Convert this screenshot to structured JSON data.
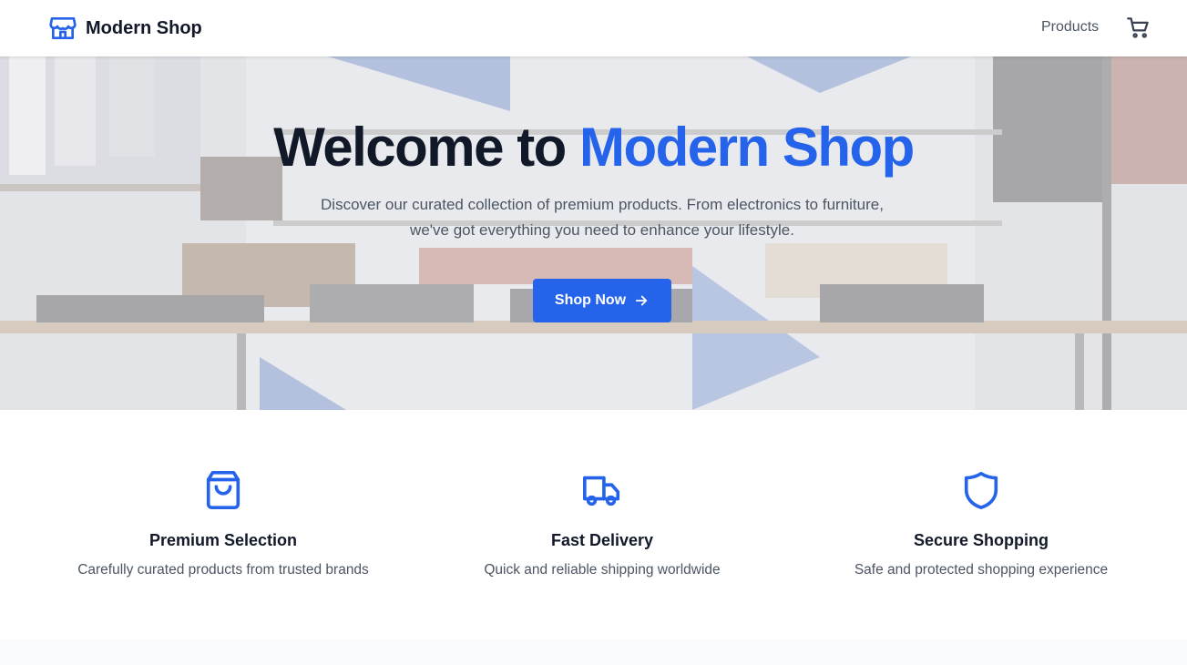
{
  "header": {
    "brand": "Modern Shop",
    "nav_products": "Products",
    "brand_icon": "store-icon",
    "cart_icon": "cart-icon"
  },
  "hero": {
    "title_prefix": "Welcome to ",
    "title_accent": "Modern Shop",
    "subtitle_line1": "Discover our curated collection of premium products. From electronics to furniture,",
    "subtitle_line2": "we've got everything you need to enhance your lifestyle.",
    "cta_label": "Shop Now",
    "cta_icon": "arrow-right-icon"
  },
  "features": [
    {
      "icon": "shopping-bag-icon",
      "title": "Premium Selection",
      "description": "Carefully curated products from trusted brands"
    },
    {
      "icon": "truck-icon",
      "title": "Fast Delivery",
      "description": "Quick and reliable shipping worldwide"
    },
    {
      "icon": "shield-icon",
      "title": "Secure Shopping",
      "description": "Safe and protected shopping experience"
    }
  ],
  "colors": {
    "accent": "#2563eb",
    "text_dark": "#111827",
    "text_muted": "#4b5563"
  }
}
